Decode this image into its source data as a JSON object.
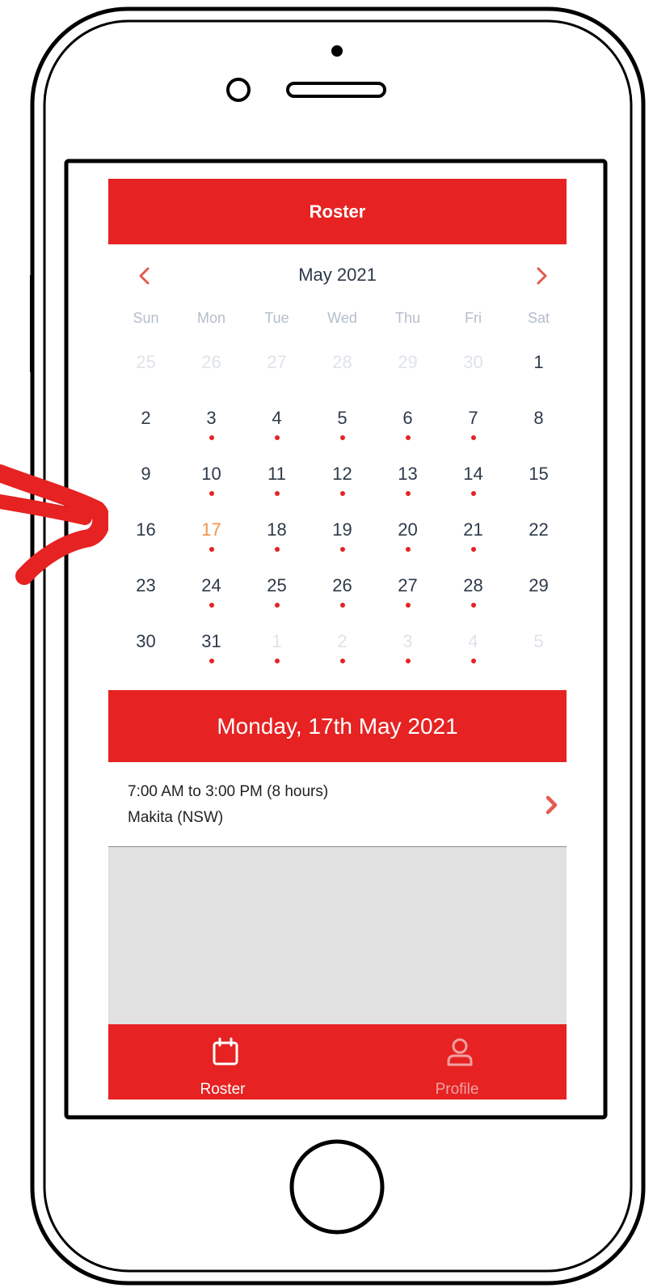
{
  "header": {
    "title": "Roster"
  },
  "calendar": {
    "month_label": "May 2021",
    "weekdays": [
      "Sun",
      "Mon",
      "Tue",
      "Wed",
      "Thu",
      "Fri",
      "Sat"
    ],
    "weeks": [
      [
        {
          "d": "25",
          "other": true
        },
        {
          "d": "26",
          "other": true
        },
        {
          "d": "27",
          "other": true
        },
        {
          "d": "28",
          "other": true
        },
        {
          "d": "29",
          "other": true
        },
        {
          "d": "30",
          "other": true
        },
        {
          "d": "1"
        }
      ],
      [
        {
          "d": "2"
        },
        {
          "d": "3",
          "dot": true
        },
        {
          "d": "4",
          "dot": true
        },
        {
          "d": "5",
          "dot": true
        },
        {
          "d": "6",
          "dot": true
        },
        {
          "d": "7",
          "dot": true
        },
        {
          "d": "8"
        }
      ],
      [
        {
          "d": "9"
        },
        {
          "d": "10",
          "dot": true
        },
        {
          "d": "11",
          "dot": true
        },
        {
          "d": "12",
          "dot": true
        },
        {
          "d": "13",
          "dot": true
        },
        {
          "d": "14",
          "dot": true
        },
        {
          "d": "15"
        }
      ],
      [
        {
          "d": "16"
        },
        {
          "d": "17",
          "dot": true,
          "today": true
        },
        {
          "d": "18",
          "dot": true
        },
        {
          "d": "19",
          "dot": true
        },
        {
          "d": "20",
          "dot": true
        },
        {
          "d": "21",
          "dot": true
        },
        {
          "d": "22"
        }
      ],
      [
        {
          "d": "23"
        },
        {
          "d": "24",
          "dot": true
        },
        {
          "d": "25",
          "dot": true
        },
        {
          "d": "26",
          "dot": true
        },
        {
          "d": "27",
          "dot": true
        },
        {
          "d": "28",
          "dot": true
        },
        {
          "d": "29"
        }
      ],
      [
        {
          "d": "30"
        },
        {
          "d": "31",
          "dot": true
        },
        {
          "d": "1",
          "other": true,
          "dot": true
        },
        {
          "d": "2",
          "other": true,
          "dot": true
        },
        {
          "d": "3",
          "other": true,
          "dot": true
        },
        {
          "d": "4",
          "other": true,
          "dot": true
        },
        {
          "d": "5",
          "other": true
        }
      ]
    ]
  },
  "selected": {
    "date_label": "Monday, 17th May 2021",
    "shift_time": "7:00 AM to 3:00 PM (8 hours)",
    "shift_site": "Makita (NSW)"
  },
  "tabs": {
    "roster_label": "Roster",
    "profile_label": "Profile"
  },
  "colors": {
    "accent": "#e62222",
    "today": "#f0924a",
    "text": "#2d3a4a",
    "muted": "#b4bdca",
    "empty_area": "#e1e1e1"
  },
  "icons": {
    "prev": "chevron-left-icon",
    "next": "chevron-right-icon",
    "roster_tab": "calendar-icon",
    "profile_tab": "person-icon"
  }
}
